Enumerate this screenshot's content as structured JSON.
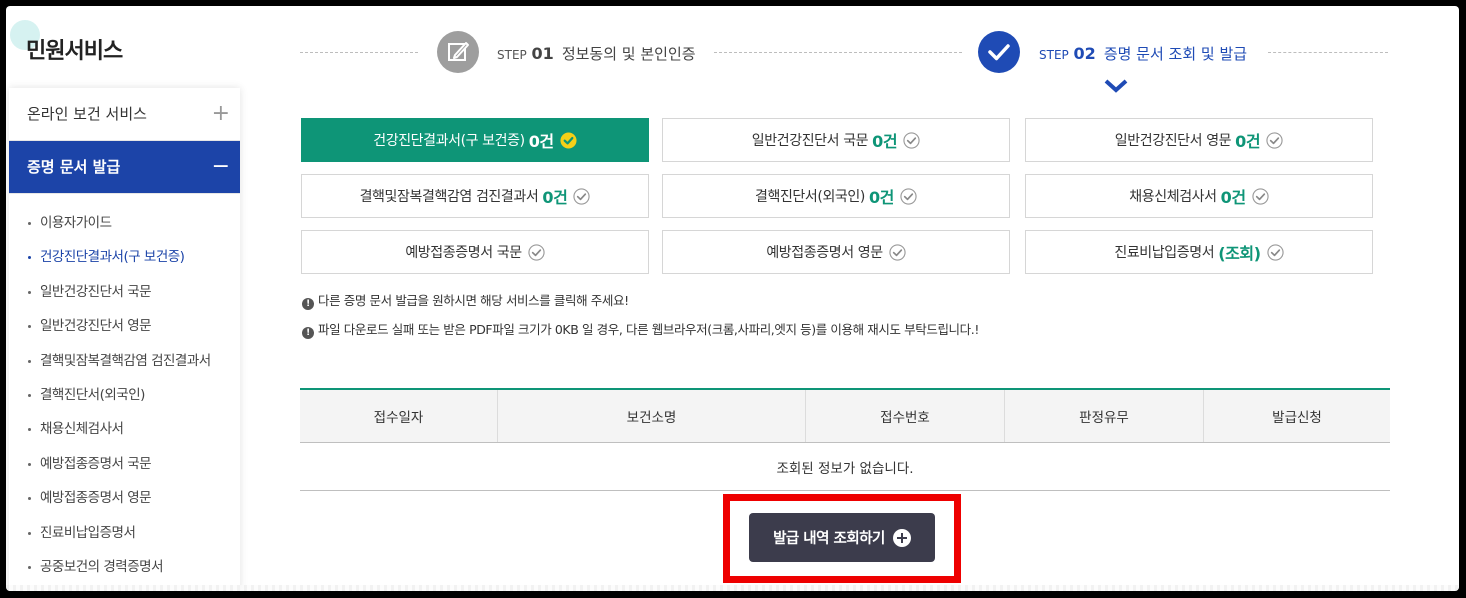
{
  "sidebar": {
    "title": "민원서비스",
    "menus": [
      {
        "label": "온라인 보건 서비스",
        "sign": "+"
      },
      {
        "label": "증명 문서 발급",
        "sign": "−"
      }
    ],
    "items": [
      {
        "label": "이용자가이드"
      },
      {
        "label": "건강진단결과서(구 보건증)"
      },
      {
        "label": "일반건강진단서 국문"
      },
      {
        "label": "일반건강진단서 영문"
      },
      {
        "label": "결핵및잠복결핵감염 검진결과서"
      },
      {
        "label": "결핵진단서(외국인)"
      },
      {
        "label": "채용신체검사서"
      },
      {
        "label": "예방접종증명서 국문"
      },
      {
        "label": "예방접종증명서 영문"
      },
      {
        "label": "진료비납입증명서"
      },
      {
        "label": "공중보건의 경력증명서"
      }
    ]
  },
  "steps": [
    {
      "label": "STEP",
      "num": "01",
      "title": "정보동의 및 본인인증"
    },
    {
      "label": "STEP",
      "num": "02",
      "title": "증명 문서 조회 및 발급"
    }
  ],
  "documents": [
    {
      "name": "건강진단결과서(구 보건증)",
      "count": "0건"
    },
    {
      "name": "일반건강진단서 국문",
      "count": "0건"
    },
    {
      "name": "일반건강진단서 영문",
      "count": "0건"
    },
    {
      "name": "결핵및잠복결핵감염 검진결과서",
      "count": "0건"
    },
    {
      "name": "결핵진단서(외국인)",
      "count": "0건"
    },
    {
      "name": "채용신체검사서",
      "count": "0건"
    },
    {
      "name": "예방접종증명서 국문",
      "count": ""
    },
    {
      "name": "예방접종증명서 영문",
      "count": ""
    },
    {
      "name": "진료비납입증명서",
      "count": "(조회)"
    }
  ],
  "notices": [
    "다른 증명 문서 발급을 원하시면 해당 서비스를 클릭해 주세요!",
    "파일 다운로드 실패 또는 받은 PDF파일 크기가 0KB 일 경우, 다른 웹브라우저(크롬,사파리,엣지 등)를 이용해 재시도 부탁드립니다.!"
  ],
  "table": {
    "headers": [
      "접수일자",
      "보건소명",
      "접수번호",
      "판정유무",
      "발급신청"
    ],
    "empty": "조회된 정보가 없습니다."
  },
  "history_button": "발급 내역 조회하기",
  "colors": {
    "brand_blue": "#1c44a8",
    "accent_green": "#0e9577",
    "dark_button": "#3c3c4c",
    "highlight_red": "#ee0000"
  },
  "icons": {
    "step1": "pencil-icon",
    "step2": "check-icon",
    "doc": "check-circle-icon",
    "notice": "exclamation-icon"
  }
}
